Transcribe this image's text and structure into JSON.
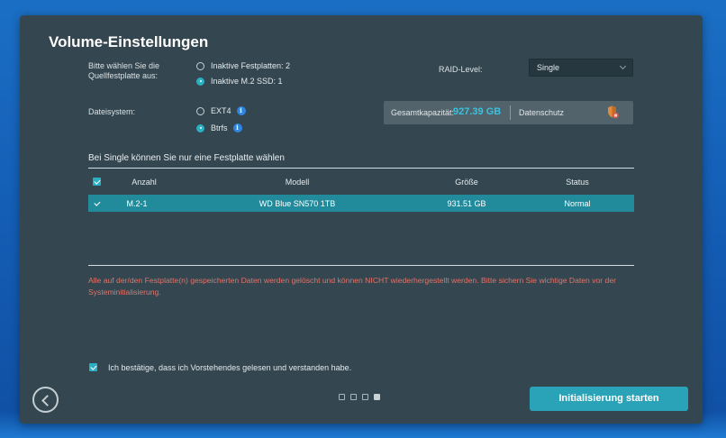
{
  "dialog": {
    "title": "Volume-Einstellungen",
    "source_label": "Bitte wählen Sie die Quellfestplatte aus:",
    "source_options": [
      {
        "label": "Inaktive Festplatten: 2",
        "checked": false
      },
      {
        "label": "Inaktive M.2 SSD: 1",
        "checked": true
      }
    ],
    "raid_label": "RAID-Level:",
    "raid_value": "Single",
    "filesystem_label": "Dateisystem:",
    "filesystem_options": [
      {
        "label": "EXT4",
        "checked": false,
        "icon": "info-icon"
      },
      {
        "label": "Btrfs",
        "checked": true,
        "icon": "info-icon"
      }
    ],
    "capacity_label": "Gesamtkapazität:",
    "capacity_value": "927.39 GB",
    "data_protection_label": "Datenschutz",
    "section_title": "Bei Single können Sie nur eine Festplatte wählen",
    "table": {
      "headers": [
        "Anzahl",
        "Modell",
        "Größe",
        "Status"
      ],
      "rows": [
        {
          "selected": true,
          "cells": [
            "M.2-1",
            "WD Blue SN570 1TB",
            "931.51 GB",
            "Normal"
          ]
        }
      ]
    },
    "warning": "Alle auf der/den Festplatte(n) gespeicherten Daten werden gelöscht und können NICHT wiederhergestellt werden. Bitte sichern Sie wichtige Daten vor der Systeminitialisierung.",
    "confirm_label": "Ich bestätige, dass ich Vorstehendes gelesen und verstanden habe.",
    "confirm_checked": true,
    "start_button": "Initialisierung starten",
    "steps": {
      "total": 4,
      "current": 4
    }
  },
  "colors": {
    "accent": "#2ab0c2",
    "selected_row": "#218b9c",
    "capacity_value": "#37c3e0",
    "warning": "#e2736a",
    "dialog_bg": "#34464f"
  }
}
